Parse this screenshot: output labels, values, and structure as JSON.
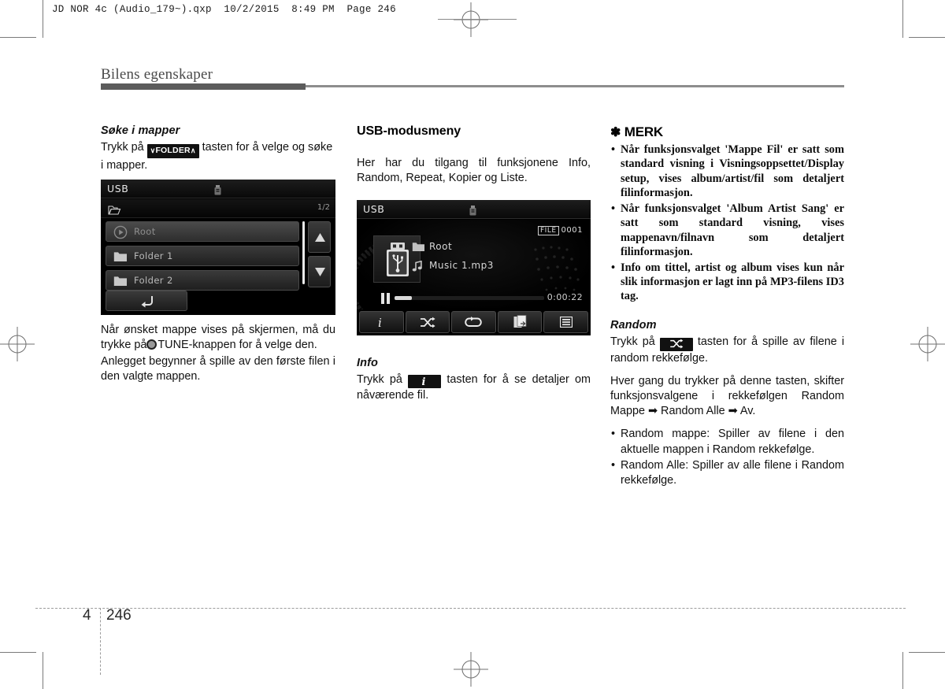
{
  "prepress": {
    "header": "JD NOR 4c (Audio_179~).qxp  10/2/2015  8:49 PM  Page 246"
  },
  "chapter": {
    "title": "Bilens egenskaper"
  },
  "footer": {
    "chapter_number": "4",
    "page_number": "246"
  },
  "left_column": {
    "heading": "Søke i mapper",
    "para1_before": "Trykk på",
    "folder_badge": {
      "down": "∨",
      "label": "FOLDER",
      "up": "∧"
    },
    "para1_after": "tasten for å velge og søke i mapper.",
    "para2": "Når ønsket mappe vises på skjermen, må du trykke på",
    "para2_knob_label": "TUNE-knappen for å velge den.",
    "para3": "Anlegget begynner å spille av den første filen i den valgte mappen."
  },
  "folder_screen": {
    "title": "USB",
    "usb_icon": "usb-drive-icon",
    "breadcrumb_icon": "open-folder-icon",
    "page_indicator": "1/2",
    "rows": [
      {
        "label": "Root",
        "icon": "play-circle-icon",
        "selected": true
      },
      {
        "label": "Folder 1",
        "icon": "folder-icon",
        "selected": false
      },
      {
        "label": "Folder 2",
        "icon": "folder-icon",
        "selected": false
      }
    ],
    "scroll_up_icon": "triangle-up-icon",
    "scroll_down_icon": "triangle-down-icon",
    "back_icon": "back-arrow-icon"
  },
  "mid_column": {
    "heading": "USB-modusmeny",
    "intro": "Her har du tilgang til funksjonene Info, Random, Repeat, Kopier og Liste.",
    "info_heading": "Info",
    "info_before": "Trykk på",
    "info_after": "tasten for å se detaljer om nåværende fil."
  },
  "player_screen": {
    "title": "USB",
    "usb_icon": "usb-drive-icon",
    "file_badge_label": "FILE",
    "file_badge_value": "0001",
    "album_art_icon": "usb-drive-icon",
    "folder_name": "Root",
    "folder_icon": "folder-icon",
    "track_name": "Music 1.mp3",
    "track_icon": "music-note-icon",
    "transport_icon": "pause-icon",
    "elapsed_time": "0:00:22",
    "toolbar": [
      {
        "name": "info-button",
        "icon": "info-i-icon"
      },
      {
        "name": "random-button",
        "icon": "shuffle-icon"
      },
      {
        "name": "repeat-button",
        "icon": "repeat-icon"
      },
      {
        "name": "copy-button",
        "icon": "copy-icon"
      },
      {
        "name": "list-button",
        "icon": "list-icon"
      }
    ]
  },
  "right_column": {
    "note_asterisk": "✽",
    "note_title": "MERK",
    "note_bullets": [
      "Når funksjonsvalget 'Mappe Fil' er satt som standard visning i Visningsoppsettet/Display setup, vises album/artist/fil som detaljert filinformasjon.",
      "Når funksjonsvalget 'Album Artist Sang' er satt som standard visning, vises mappenavn/filnavn som detaljert filinformasjon.",
      "Info om tittel, artist og album vises kun når slik informasjon er lagt inn på MP3-filens ID3 tag."
    ],
    "random_heading": "Random",
    "random_before": "Trykk på",
    "random_after": "tasten for å spille av filene i random rekkefølge.",
    "random_cycle": "Hver gang du trykker på denne tasten, skifter funksjonsvalgene i rekkefølgen Random Mappe ➡ Random Alle ➡ Av.",
    "random_bullets": [
      "Random mappe: Spiller av filene i den aktuelle mappen i Random rekkefølge.",
      "Random Alle: Spiller av alle filene i Random rekkefølge."
    ]
  },
  "colors": {
    "title_bar_dark": "#5c5c5c",
    "title_bar_light": "#8d8d8d",
    "screen_bg": "#000000",
    "text": "#111111"
  }
}
